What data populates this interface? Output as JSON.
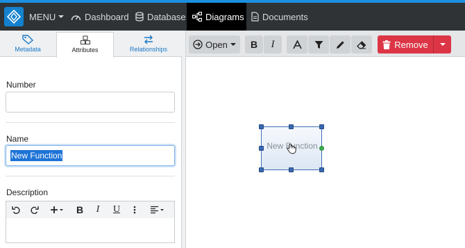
{
  "nav": {
    "menu_label": "MENU",
    "items": [
      {
        "label": "Dashboard"
      },
      {
        "label": "Database"
      },
      {
        "label": "Diagrams"
      },
      {
        "label": "Documents"
      }
    ]
  },
  "left_panel": {
    "tabs": [
      {
        "label": "Metadata"
      },
      {
        "label": "Attributes"
      },
      {
        "label": "Relationships"
      }
    ],
    "fields": {
      "number_label": "Number",
      "number_value": "",
      "name_label": "Name",
      "name_value": "New Function",
      "description_label": "Description"
    }
  },
  "editor_toolbar": {
    "bold": "B",
    "italic": "I",
    "underline": "U"
  },
  "toolbar": {
    "open_label": "Open",
    "remove_label": "Remove"
  },
  "canvas": {
    "node_label": "New Function"
  }
}
